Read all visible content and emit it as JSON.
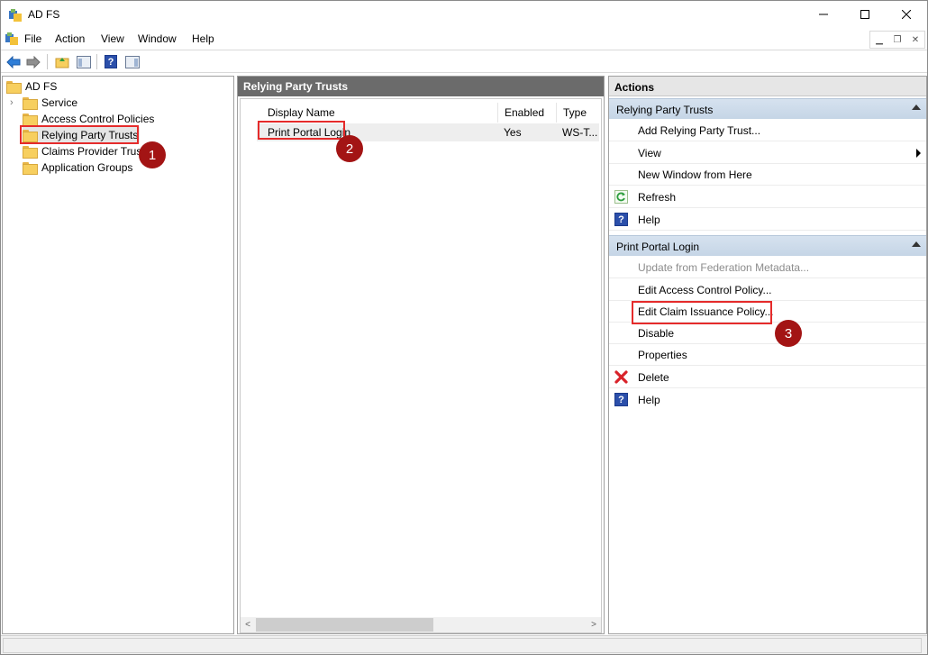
{
  "window": {
    "title": "AD FS",
    "controls": {
      "minimize": "minimize",
      "maximize": "maximize",
      "close": "close"
    }
  },
  "menu": {
    "items": [
      "File",
      "Action",
      "View",
      "Window",
      "Help"
    ]
  },
  "toolbar": {
    "buttons": [
      "back-arrow-icon",
      "forward-arrow-icon",
      "up-folder-icon",
      "show-hide-console-tree-icon",
      "help-icon",
      "show-hide-action-pane-icon"
    ]
  },
  "tree": {
    "root": "AD FS",
    "items": [
      {
        "label": "Service",
        "expandable": true
      },
      {
        "label": "Access Control Policies"
      },
      {
        "label": "Relying Party Trusts",
        "selected": true
      },
      {
        "label": "Claims Provider Trusts"
      },
      {
        "label": "Application Groups"
      }
    ]
  },
  "center": {
    "header": "Relying Party Trusts",
    "columns": [
      "Display Name",
      "Enabled",
      "Type"
    ],
    "rows": [
      {
        "display_name": "Print Portal Login",
        "enabled": "Yes",
        "type": "WS-T..."
      }
    ]
  },
  "actions": {
    "title": "Actions",
    "group1": {
      "label": "Relying Party Trusts",
      "items": [
        {
          "label": "Add Relying Party Trust...",
          "icon": ""
        },
        {
          "label": "View",
          "icon": "",
          "submenu": true
        },
        {
          "label": "New Window from Here",
          "icon": ""
        },
        {
          "label": "Refresh",
          "icon": "refresh-icon"
        },
        {
          "label": "Help",
          "icon": "help-icon"
        }
      ]
    },
    "group2": {
      "label": "Print Portal Login",
      "items": [
        {
          "label": "Update from Federation Metadata...",
          "icon": "",
          "disabled": true
        },
        {
          "label": "Edit Access Control Policy...",
          "icon": ""
        },
        {
          "label": "Edit Claim Issuance Policy...",
          "icon": ""
        },
        {
          "label": "Disable",
          "icon": ""
        },
        {
          "label": "Properties",
          "icon": ""
        },
        {
          "label": "Delete",
          "icon": "delete-icon"
        },
        {
          "label": "Help",
          "icon": "help-icon"
        }
      ]
    }
  },
  "annotations": {
    "badge1": "1",
    "badge2": "2",
    "badge3": "3",
    "color": "#a31414",
    "box_color": "#e52b2b"
  },
  "colors": {
    "pane_header": "#6b6b6b",
    "action_group": "#c5d5e6"
  }
}
